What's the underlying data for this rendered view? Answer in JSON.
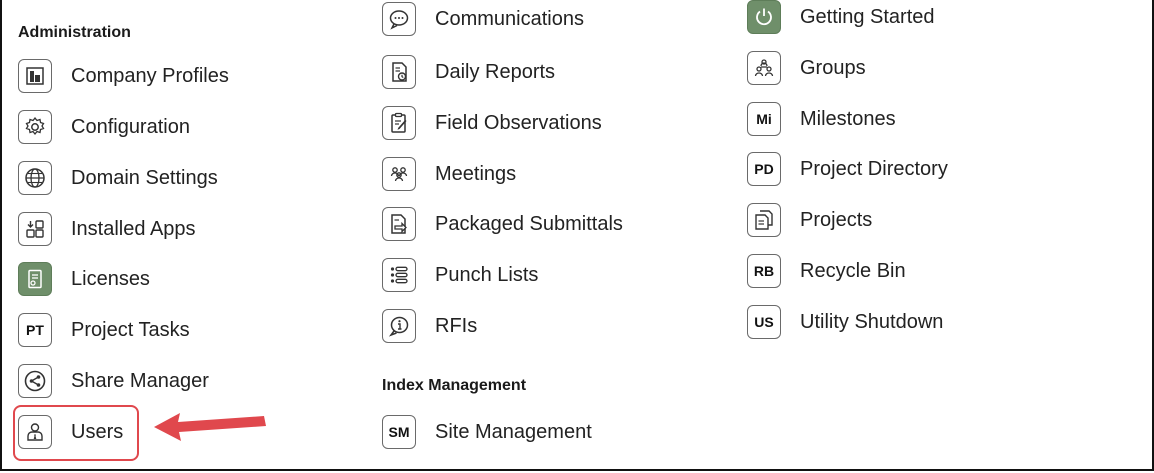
{
  "sections": {
    "administration": "Administration",
    "index_management": "Index Management"
  },
  "col1": [
    {
      "label": "Company Profiles",
      "icon": "building-icon"
    },
    {
      "label": "Configuration",
      "icon": "gear-icon"
    },
    {
      "label": "Domain Settings",
      "icon": "globe-icon"
    },
    {
      "label": "Installed Apps",
      "icon": "apps-icon"
    },
    {
      "label": "Licenses",
      "icon": "license-icon"
    },
    {
      "label": "Project Tasks",
      "icon": "pt-icon",
      "abbr": "PT"
    },
    {
      "label": "Share Manager",
      "icon": "share-icon"
    },
    {
      "label": "Users",
      "icon": "user-icon"
    }
  ],
  "col2": [
    {
      "label": "Communications",
      "icon": "chat-icon"
    },
    {
      "label": "Daily Reports",
      "icon": "daily-report-icon"
    },
    {
      "label": "Field Observations",
      "icon": "clipboard-pen-icon"
    },
    {
      "label": "Meetings",
      "icon": "people-group-icon"
    },
    {
      "label": "Packaged Submittals",
      "icon": "submittal-icon"
    },
    {
      "label": "Punch Lists",
      "icon": "list-icon"
    },
    {
      "label": "RFIs",
      "icon": "info-bubble-icon"
    },
    {
      "label": "Site Management",
      "icon": "sm-icon",
      "abbr": "SM"
    }
  ],
  "col3": [
    {
      "label": "Getting Started",
      "icon": "power-icon"
    },
    {
      "label": "Groups",
      "icon": "groups-icon"
    },
    {
      "label": "Milestones",
      "icon": "mi-icon",
      "abbr": "Mi"
    },
    {
      "label": "Project Directory",
      "icon": "pd-icon",
      "abbr": "PD"
    },
    {
      "label": "Projects",
      "icon": "projects-icon"
    },
    {
      "label": "Recycle Bin",
      "icon": "rb-icon",
      "abbr": "RB"
    },
    {
      "label": "Utility Shutdown",
      "icon": "us-icon",
      "abbr": "US"
    }
  ],
  "colors": {
    "highlight": "#e0484d",
    "arrow": "#e0484d",
    "filled_icon": "#6f8f6a"
  }
}
